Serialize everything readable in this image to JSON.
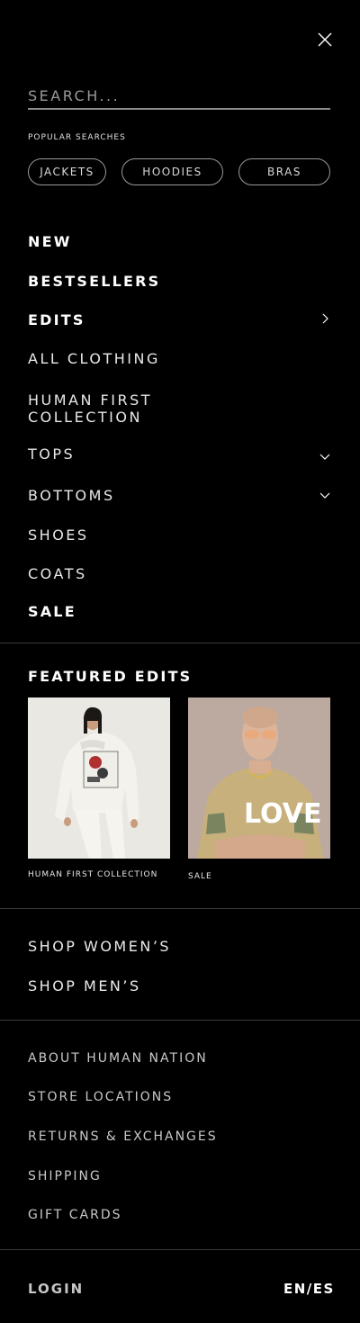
{
  "search": {
    "placeholder": "SEARCH..."
  },
  "popular": {
    "label": "POPULAR SEARCHES",
    "chips": [
      "JACKETS",
      "HOODIES",
      "BRAS"
    ]
  },
  "nav": {
    "new": "NEW",
    "bestsellers": "BESTSELLERS",
    "edits": "EDITS",
    "all_clothing": "ALL CLOTHING",
    "human_first_1": "HUMAN FIRST",
    "human_first_2": "COLLECTION",
    "tops": "TOPS",
    "bottoms": "BOTTOMS",
    "shoes": "SHOES",
    "coats": "COATS",
    "sale": "SALE"
  },
  "featured": {
    "title": "FEATURED EDITS",
    "items": [
      {
        "caption": "HUMAN FIRST COLLECTION"
      },
      {
        "caption": "SALE",
        "graphic_text": "LOVE"
      }
    ]
  },
  "shop": {
    "womens": "SHOP WOMEN’S",
    "mens": "SHOP MEN’S"
  },
  "footer_links": [
    "ABOUT HUMAN NATION",
    "STORE LOCATIONS",
    "RETURNS & EXCHANGES",
    "SHIPPING",
    "GIFT CARDS"
  ],
  "account": {
    "login": "LOGIN",
    "language": "EN/ES"
  },
  "icons": {
    "close": "close-icon",
    "chevron_right": "chevron-right-icon",
    "chevron_down": "chevron-down-icon"
  },
  "colors": {
    "background": "#000000",
    "text": "#ffffff",
    "muted": "#c6c6c6"
  }
}
